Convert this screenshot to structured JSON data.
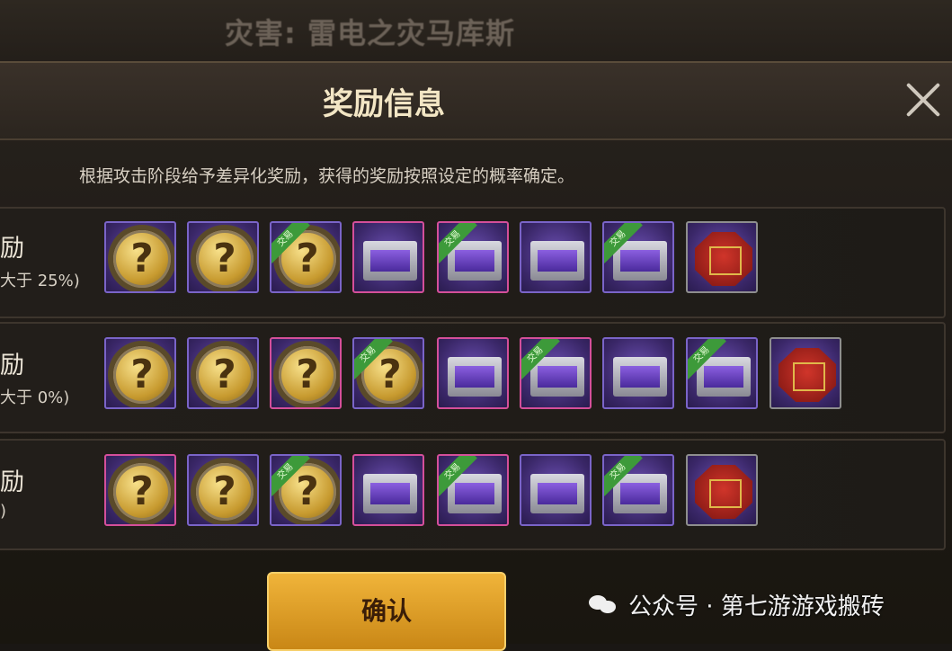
{
  "background_title": "灾害: 雷电之灾马库斯",
  "dialog": {
    "title": "奖励信息",
    "description": "根据攻击阶段给予差异化奖励，获得的奖励按照设定的概率确定。",
    "confirm_label": "确认"
  },
  "rows": [
    {
      "label": "励",
      "sub": "大于 25%)"
    },
    {
      "label": "励",
      "sub": "大于 0%)"
    },
    {
      "label": "励",
      "sub": ")"
    }
  ],
  "watermark": {
    "text": "公众号 · 第七游游戏搬砖"
  },
  "reward_icon_names": [
    "mystery-coin-icon",
    "mystery-box-icon",
    "red-chest-icon"
  ],
  "tag_text": "交易"
}
